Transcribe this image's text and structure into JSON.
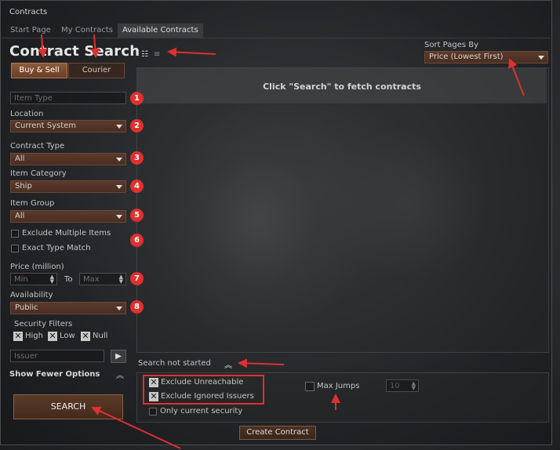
{
  "window": {
    "title": "Contracts"
  },
  "tabs": [
    {
      "label": "Start Page"
    },
    {
      "label": "My Contracts"
    },
    {
      "label": "Available Contracts"
    }
  ],
  "search": {
    "heading": "Contract Search",
    "buy_sell_label": "Buy & Sell",
    "courier_label": "Courier",
    "item_type_placeholder": "Item Type",
    "location_label": "Location",
    "location_value": "Current System",
    "contract_type_label": "Contract Type",
    "contract_type_value": "All",
    "item_category_label": "Item Category",
    "item_category_value": "Ship",
    "item_group_label": "Item Group",
    "item_group_value": "All",
    "exclude_multiple_label": "Exclude Multiple Items",
    "exact_type_label": "Exact Type Match",
    "price_label": "Price (million)",
    "price_min_placeholder": "Min",
    "price_to": "To",
    "price_max_placeholder": "Max",
    "availability_label": "Availability",
    "availability_value": "Public",
    "security_filters_label": "Security Filters",
    "security": [
      {
        "label": "High",
        "checked": true
      },
      {
        "label": "Low",
        "checked": true
      },
      {
        "label": "Null",
        "checked": true
      }
    ],
    "issuer_placeholder": "Issuer",
    "show_fewer_label": "Show Fewer Options",
    "search_button": "SEARCH"
  },
  "badges": [
    "1",
    "2",
    "3",
    "4",
    "5",
    "6",
    "7",
    "8"
  ],
  "results": {
    "sort_label": "Sort Pages By",
    "sort_value": "Price (Lowest First)",
    "empty_message": "Click \"Search\" to fetch contracts",
    "status": "Search not started"
  },
  "filters": {
    "exclude_unreachable": "Exclude Unreachable",
    "exclude_ignored": "Exclude Ignored Issuers",
    "only_current_security": "Only current security",
    "max_jumps_label": "Max Jumps",
    "max_jumps_value": "10"
  },
  "create_contract": "Create Contract",
  "colors": {
    "accent_red": "#e03030",
    "button_brown": "#4a2e22"
  }
}
